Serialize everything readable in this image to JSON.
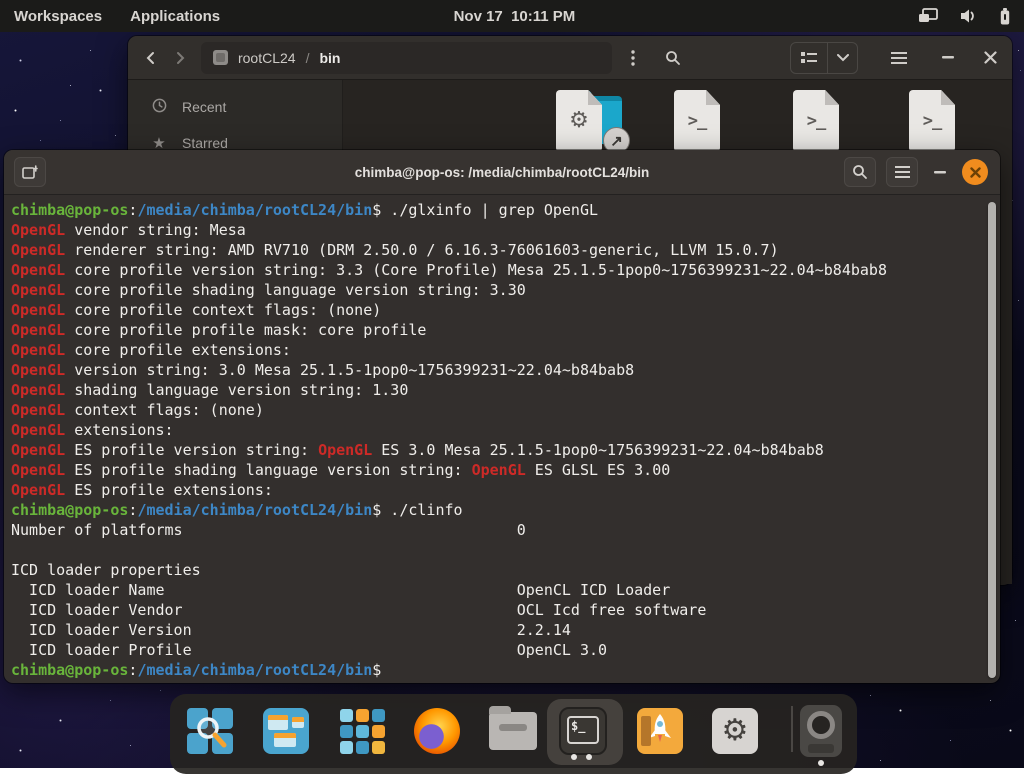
{
  "topbar": {
    "workspaces_label": "Workspaces",
    "applications_label": "Applications",
    "clock": "Nov 17  10:11 PM",
    "tray_icons": [
      "display-mirror-icon",
      "volume-icon",
      "battery-icon"
    ]
  },
  "files_window": {
    "path": {
      "device": "rootCL24",
      "separator": "/",
      "folder": "bin"
    },
    "toolbar_icons": [
      "back-icon",
      "forward-icon",
      "kebab-menu-icon",
      "search-icon",
      "list-view-icon",
      "dropdown-icon",
      "hamburger-menu-icon",
      "minimize-icon",
      "close-icon"
    ],
    "sidebar_items": [
      {
        "icon": "recent-clock-icon",
        "label": "Recent"
      },
      {
        "icon": "star-icon",
        "label": "Starred"
      }
    ],
    "grid_items": [
      {
        "icon": "folder-shortcut-icon"
      },
      {
        "icon": "executable-file-icon"
      },
      {
        "icon": "script-file-icon"
      },
      {
        "icon": "script-file-icon"
      },
      {
        "icon": "script-file-icon"
      },
      {
        "icon": "executable-file-icon"
      }
    ]
  },
  "terminal": {
    "title": "chimba@pop-os: /media/chimba/rootCL24/bin",
    "header_icons": [
      "new-tab-icon",
      "search-icon",
      "hamburger-menu-icon",
      "minimize-icon",
      "close-icon"
    ],
    "palette": {
      "fg": "#efedea",
      "green": "#69b53b",
      "blue": "#3d87c6",
      "red": "#cd2a27",
      "bg": "#332f2d"
    },
    "lines": [
      [
        [
          "chimba@pop-os",
          "green"
        ],
        [
          ":",
          "fg"
        ],
        [
          "/media/chimba/rootCL24/bin",
          "blue"
        ],
        [
          "$ ./glxinfo | grep OpenGL",
          "fg"
        ]
      ],
      [
        [
          "OpenGL",
          "red"
        ],
        [
          " vendor string: Mesa",
          "fg"
        ]
      ],
      [
        [
          "OpenGL",
          "red"
        ],
        [
          " renderer string: AMD RV710 (DRM 2.50.0 / 6.16.3-76061603-generic, LLVM 15.0.7)",
          "fg"
        ]
      ],
      [
        [
          "OpenGL",
          "red"
        ],
        [
          " core profile version string: 3.3 (Core Profile) Mesa 25.1.5-1pop0~1756399231~22.04~b84bab8",
          "fg"
        ]
      ],
      [
        [
          "OpenGL",
          "red"
        ],
        [
          " core profile shading language version string: 3.30",
          "fg"
        ]
      ],
      [
        [
          "OpenGL",
          "red"
        ],
        [
          " core profile context flags: (none)",
          "fg"
        ]
      ],
      [
        [
          "OpenGL",
          "red"
        ],
        [
          " core profile profile mask: core profile",
          "fg"
        ]
      ],
      [
        [
          "OpenGL",
          "red"
        ],
        [
          " core profile extensions:",
          "fg"
        ]
      ],
      [
        [
          "OpenGL",
          "red"
        ],
        [
          " version string: 3.0 Mesa 25.1.5-1pop0~1756399231~22.04~b84bab8",
          "fg"
        ]
      ],
      [
        [
          "OpenGL",
          "red"
        ],
        [
          " shading language version string: 1.30",
          "fg"
        ]
      ],
      [
        [
          "OpenGL",
          "red"
        ],
        [
          " context flags: (none)",
          "fg"
        ]
      ],
      [
        [
          "OpenGL",
          "red"
        ],
        [
          " extensions:",
          "fg"
        ]
      ],
      [
        [
          "OpenGL",
          "red"
        ],
        [
          " ES profile version string: ",
          "fg"
        ],
        [
          "OpenGL",
          "red"
        ],
        [
          " ES 3.0 Mesa 25.1.5-1pop0~1756399231~22.04~b84bab8",
          "fg"
        ]
      ],
      [
        [
          "OpenGL",
          "red"
        ],
        [
          " ES profile shading language version string: ",
          "fg"
        ],
        [
          "OpenGL",
          "red"
        ],
        [
          " ES GLSL ES 3.00",
          "fg"
        ]
      ],
      [
        [
          "OpenGL",
          "red"
        ],
        [
          " ES profile extensions:",
          "fg"
        ]
      ],
      [
        [
          "chimba@pop-os",
          "green"
        ],
        [
          ":",
          "fg"
        ],
        [
          "/media/chimba/rootCL24/bin",
          "blue"
        ],
        [
          "$ ./clinfo",
          "fg"
        ]
      ],
      [
        [
          "Number of platforms                                     0",
          "fg"
        ]
      ],
      [],
      [
        [
          "ICD loader properties",
          "fg"
        ]
      ],
      [
        [
          "  ICD loader Name                                       OpenCL ICD Loader",
          "fg"
        ]
      ],
      [
        [
          "  ICD loader Vendor                                     OCL Icd free software",
          "fg"
        ]
      ],
      [
        [
          "  ICD loader Version                                    2.2.14",
          "fg"
        ]
      ],
      [
        [
          "  ICD loader Profile                                    OpenCL 3.0",
          "fg"
        ]
      ],
      [
        [
          "chimba@pop-os",
          "green"
        ],
        [
          ":",
          "fg"
        ],
        [
          "/media/chimba/rootCL24/bin",
          "blue"
        ],
        [
          "$ ",
          "fg"
        ]
      ]
    ]
  },
  "dock": {
    "items": [
      {
        "icon": "launcher-search-icon",
        "running_dots": 0,
        "active": false
      },
      {
        "icon": "workspaces-overview-icon",
        "running_dots": 0,
        "active": false
      },
      {
        "icon": "applications-grid-icon",
        "running_dots": 0,
        "active": false
      },
      {
        "icon": "firefox-icon",
        "running_dots": 0,
        "active": false
      },
      {
        "icon": "files-folder-icon",
        "running_dots": 0,
        "active": false
      },
      {
        "icon": "terminal-icon",
        "running_dots": 2,
        "active": true
      },
      {
        "icon": "pop-shop-rocket-icon",
        "running_dots": 0,
        "active": false
      },
      {
        "icon": "settings-gear-icon",
        "running_dots": 0,
        "active": false
      },
      {
        "icon": "camera-app-icon",
        "running_dots": 1,
        "active": false
      }
    ]
  }
}
